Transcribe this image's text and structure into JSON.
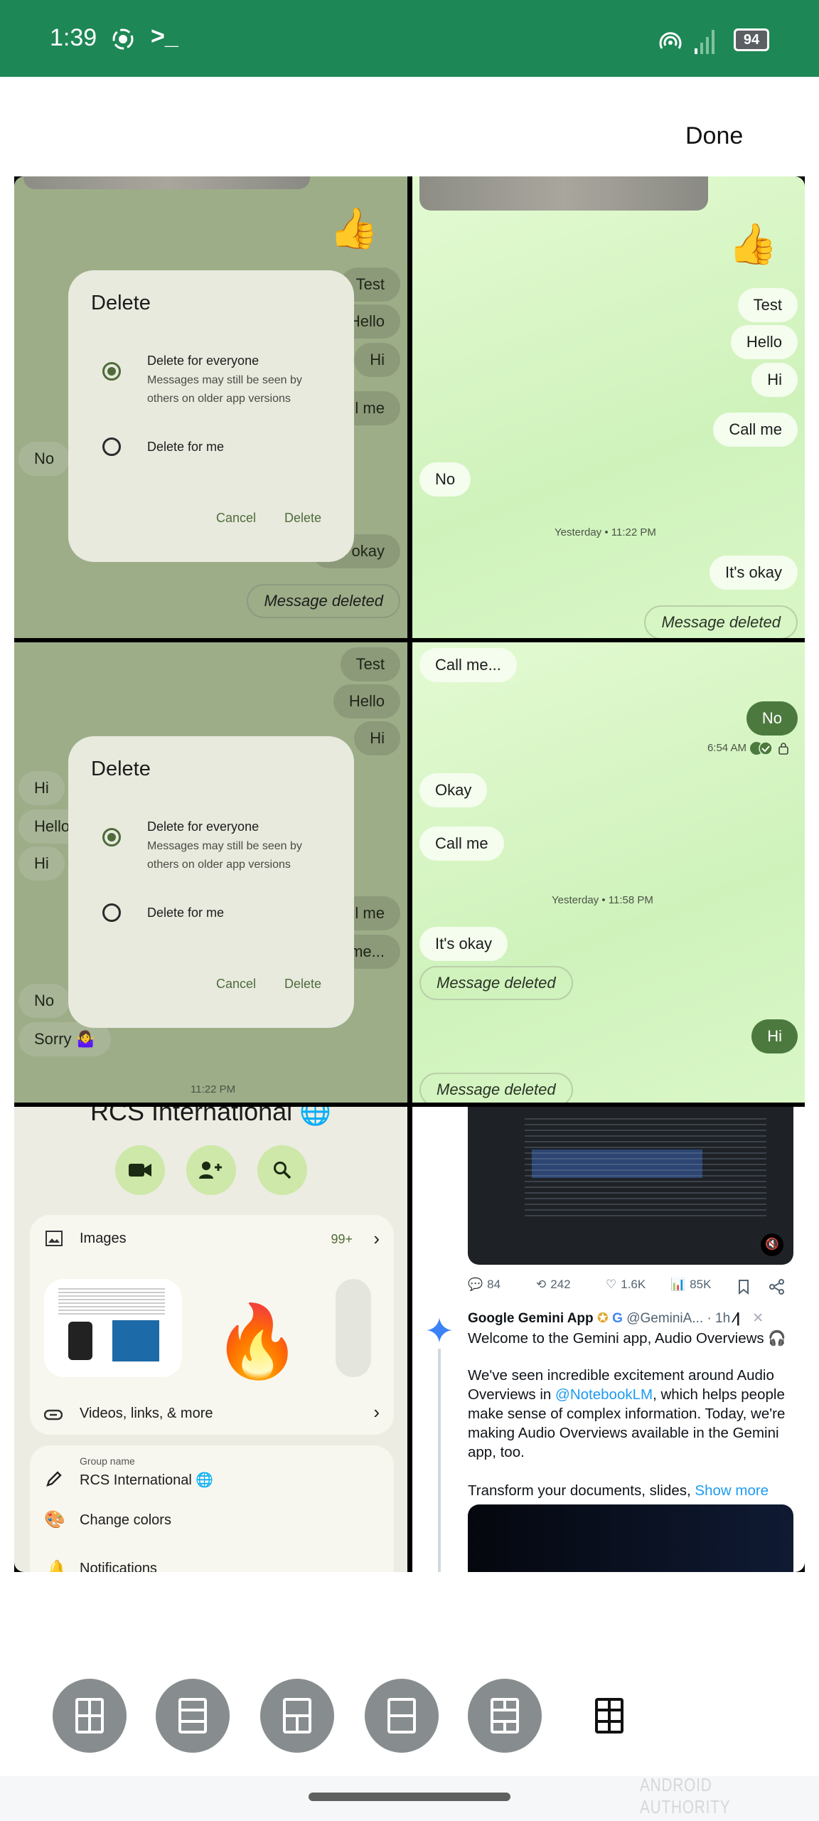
{
  "status_bar": {
    "time": "1:39",
    "battery": "94",
    "icons": [
      "record-icon",
      "terminal-icon",
      "hotspot-icon",
      "signal-icon",
      "battery-icon"
    ]
  },
  "header": {
    "done_label": "Done"
  },
  "panel1": {
    "bubbles": [
      "Test",
      "Hello",
      "Hi",
      "Call me",
      "No",
      "It's okay",
      "Message deleted"
    ],
    "dialog": {
      "title": "Delete",
      "option1": "Delete for everyone",
      "option1_sub1": "Messages may still be seen by",
      "option1_sub2": "others on older app versions",
      "option2": "Delete for me",
      "cancel": "Cancel",
      "delete": "Delete",
      "selected": "Delete for everyone"
    }
  },
  "panel2": {
    "bubbles": [
      "Test",
      "Hello",
      "Hi",
      "Call me",
      "No",
      "It's okay",
      "Message deleted"
    ],
    "timestamp": "Yesterday • 11:22 PM"
  },
  "panel3": {
    "bubbles": [
      "Test",
      "Hello",
      "Hi",
      "Hi",
      "Hello",
      "Hi",
      "Call me",
      "Call me...",
      "No",
      "Sorry 🤷‍♀️"
    ],
    "timestamp": "11:22 PM",
    "dialog": {
      "title": "Delete",
      "option1": "Delete for everyone",
      "option1_sub1": "Messages may still be seen by",
      "option1_sub2": "others on older app versions",
      "option2": "Delete for me",
      "cancel": "Cancel",
      "delete": "Delete"
    }
  },
  "panel4": {
    "bubbles": [
      "Call me...",
      "No",
      "Okay",
      "Call me",
      "It's okay",
      "Message deleted",
      "Hi",
      "Message deleted"
    ],
    "sent_time": "6:54 AM",
    "timestamp": "Yesterday • 11:58 PM"
  },
  "panel5": {
    "title": "RCS International 🌐",
    "images_label": "Images",
    "images_count": "99+",
    "videos_label": "Videos, links, & more",
    "group_name_label": "Group name",
    "group_name_value": "RCS International 🌐",
    "change_colors": "Change colors",
    "notifications": "Notifications"
  },
  "panel6": {
    "stats": {
      "replies": "84",
      "reposts": "242",
      "likes": "1.6K",
      "views": "85K"
    },
    "author": "Google Gemini App",
    "handle": "@GeminiA...",
    "age": "· 1h",
    "line1": "Welcome to the Gemini app, Audio Overviews 🎧",
    "para_a": "We've seen incredible excitement around Audio Overviews in ",
    "mention": "@NotebookLM",
    "para_b": ", which helps people make sense of complex information. Today, we're making Audio Overviews available in the Gemini app, too.",
    "line3": "Transform your documents, slides, ",
    "show_more": "Show more"
  },
  "layout_options": [
    "grid-2x2-icon",
    "rows-3-icon",
    "top-split-icon",
    "rows-2-icon",
    "mixed-grid-icon",
    "grid-3x2-icon"
  ],
  "watermark": "ANDROID AUTHORITY",
  "colors": {
    "status_bar": "#1e8756",
    "sent_bubble": "#4c7a3e",
    "accent_link": "#1d9bf0"
  }
}
